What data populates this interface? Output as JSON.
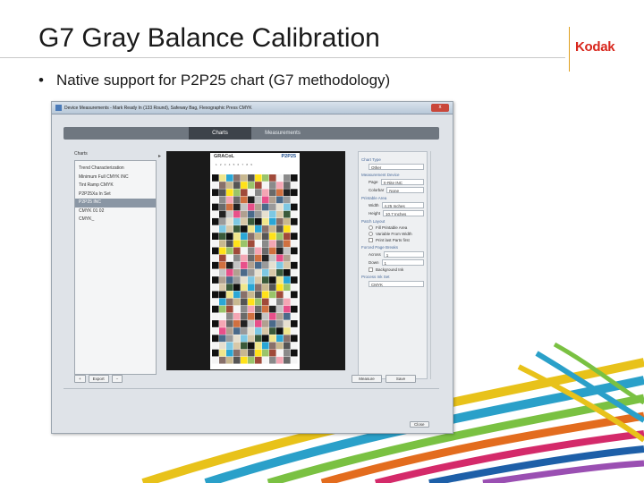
{
  "slide": {
    "title": "G7 Gray Balance Calibration",
    "logo": "Kodak",
    "bullet_marker": "•",
    "bullet_text": "Native support for P2P25 chart (G7 methodology)"
  },
  "dialog": {
    "window_title": "Device Measurements - Mark Ready In  (133 Round), Safeway Bag, Flexographic Press CMYK",
    "close_label": "x",
    "tabs": [
      {
        "label": "Charts",
        "active": true
      },
      {
        "label": "Measurements",
        "active": false
      }
    ],
    "charts_label": "Charts",
    "chart_list": [
      {
        "label": "Trend Characterization",
        "selected": false
      },
      {
        "label": "Minimum Full CMYK INC",
        "selected": false
      },
      {
        "label": "Tint Ramp CMYK",
        "selected": false
      },
      {
        "label": "P2P25Xa In Set",
        "selected": false
      },
      {
        "label": "P2P25 INC",
        "selected": true
      },
      {
        "label": "CMYK 01 02",
        "selected": false
      },
      {
        "label": "CMYK_",
        "selected": false
      }
    ],
    "preview_chart": {
      "brand": "GRACoL",
      "code": "P2P25",
      "scale": "1 2 3 4 5 6 7 8 9"
    },
    "settings": {
      "chart_type_label": "Chart Type",
      "chart_type_value": "Other",
      "measurement_device_label": "Measurement Device",
      "page_label": "Page",
      "page_value": "X-Rite INC",
      "colorbar_label": "Colorbar",
      "colorbar_value": "None",
      "printable_area_label": "Printable Area",
      "width_label": "Width",
      "width_value": "4.25 Inches",
      "height_label": "Height",
      "height_value": "10.7 Inches",
      "patch_layout_label": "Patch Layout",
      "fill_printable_label": "Fill Printable Area",
      "variable_from_width_label": "Variable From Width",
      "print_last_parts_label": "Print last Parts first",
      "forced_page_breaks_label": "Forced Page Breaks",
      "across_label": "Across",
      "across_value": "1",
      "down_label": "Down",
      "down_value": "1",
      "background_ink_label": "Background Ink",
      "process_ink_set_label": "Process Ink Set",
      "process_ink_set_value": "CMYK"
    },
    "buttons": {
      "add": "+",
      "export": "Export",
      "remove": "−",
      "measure": "Measure",
      "save": "Save",
      "close": "Close"
    }
  },
  "colors": {
    "title_rule": "#c8c8c8",
    "logo_red": "#d8261c",
    "logo_rule": "#e0a020"
  }
}
